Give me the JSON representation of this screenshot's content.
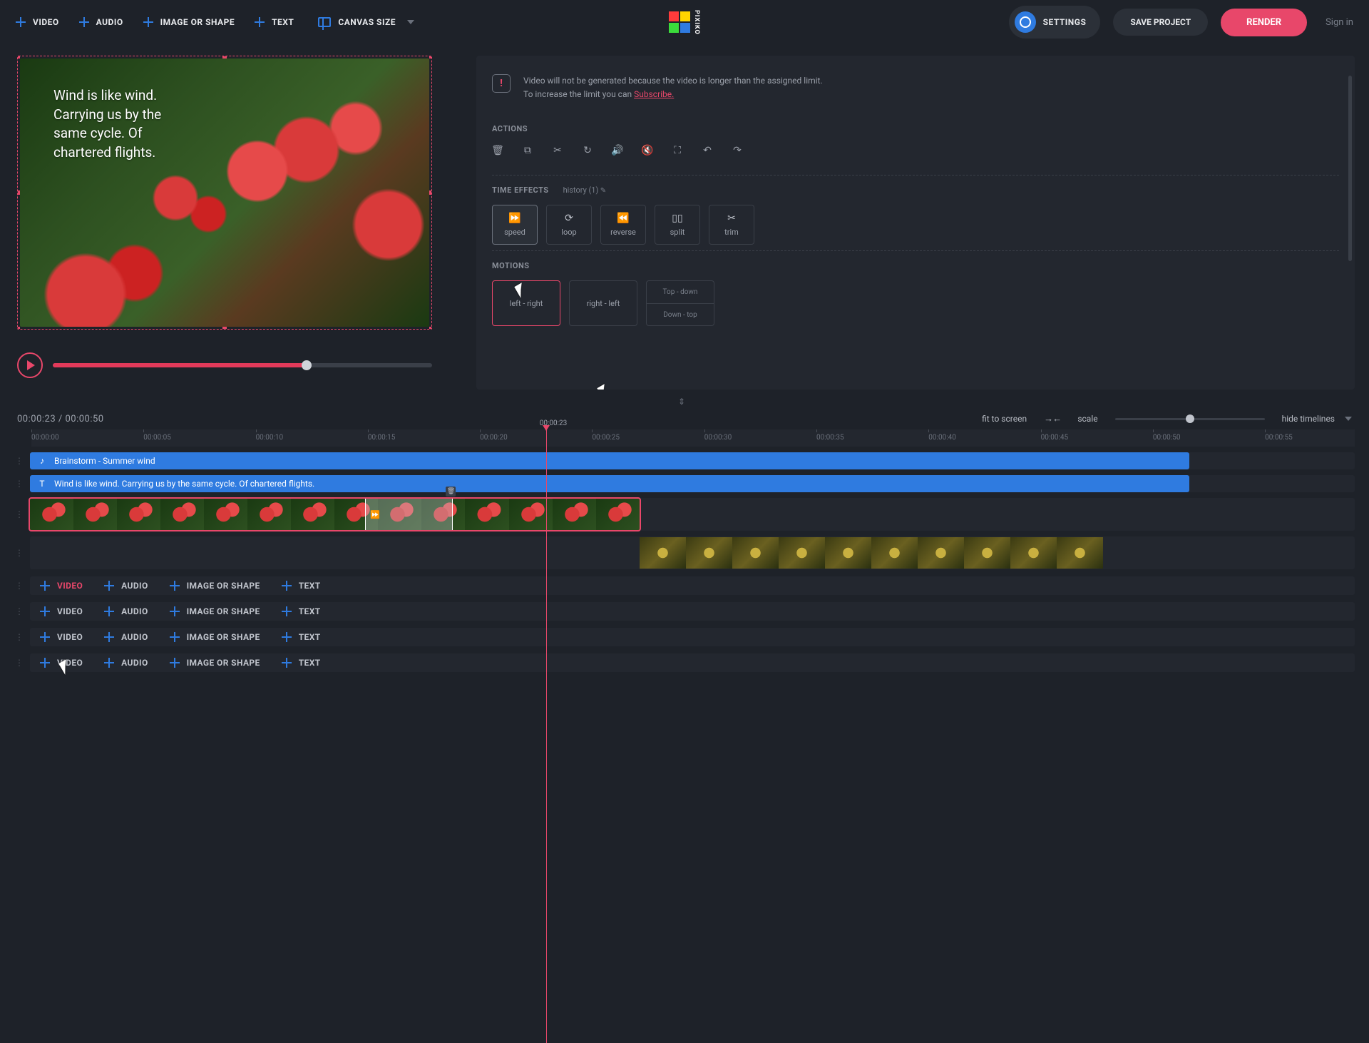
{
  "toolbar": {
    "video": "VIDEO",
    "audio": "AUDIO",
    "image": "IMAGE OR SHAPE",
    "text": "TEXT",
    "canvas_size": "CANVAS SIZE"
  },
  "logo_text": "PIXIKO",
  "top_right": {
    "settings": "SETTINGS",
    "save": "SAVE PROJECT",
    "render": "RENDER",
    "signin": "Sign in"
  },
  "preview": {
    "caption": "Wind is like wind. Carrying us by the same cycle. Of chartered flights.",
    "progress_pct": 67
  },
  "panel": {
    "warning_line1": "Video will not be generated because the video is longer than the assigned limit.",
    "warning_line2_a": "To increase the limit you can ",
    "warning_subscribe": "Subscribe.",
    "actions_label": "ACTIONS",
    "time_effects_label": "TIME EFFECTS",
    "history_label": "history (1)",
    "te": {
      "speed": "speed",
      "loop": "loop",
      "reverse": "reverse",
      "split": "split",
      "trim": "trim"
    },
    "motions_label": "MOTIONS",
    "mo": {
      "lr": "left - right",
      "rl": "right - left",
      "td": "Top - down",
      "dt": "Down - top"
    }
  },
  "timeline": {
    "current": "00:00:23",
    "total": "00:00:50",
    "cur_float": "00:00:23",
    "fit": "fit to screen",
    "scale": "scale",
    "hide": "hide timelines",
    "ticks": [
      "00:00:00",
      "00:00:05",
      "00:00:10",
      "00:00:15",
      "00:00:20",
      "00:00:25",
      "00:00:30",
      "00:00:35",
      "00:00:40",
      "00:00:45",
      "00:00:50",
      "00:00:55"
    ],
    "playhead_pct": 39.4,
    "audio_clip": {
      "label": "Brainstorm - Summer wind",
      "left_pct": 0,
      "width_pct": 87.5
    },
    "text_clip": {
      "label": "Wind is like wind. Carrying us by the same cycle. Of chartered flights.",
      "left_pct": 0,
      "width_pct": 87.5
    },
    "video_clip1": {
      "left_pct": 0,
      "width_pct": 46,
      "thumbs": 14,
      "speed_seg": {
        "left_pct": 25.3,
        "width_pct": 6.6
      }
    },
    "video_clip2": {
      "left_pct": 46,
      "width_pct": 35,
      "thumbs": 10
    },
    "add_labels": {
      "video": "VIDEO",
      "audio": "AUDIO",
      "image": "IMAGE OR SHAPE",
      "text": "TEXT"
    }
  }
}
